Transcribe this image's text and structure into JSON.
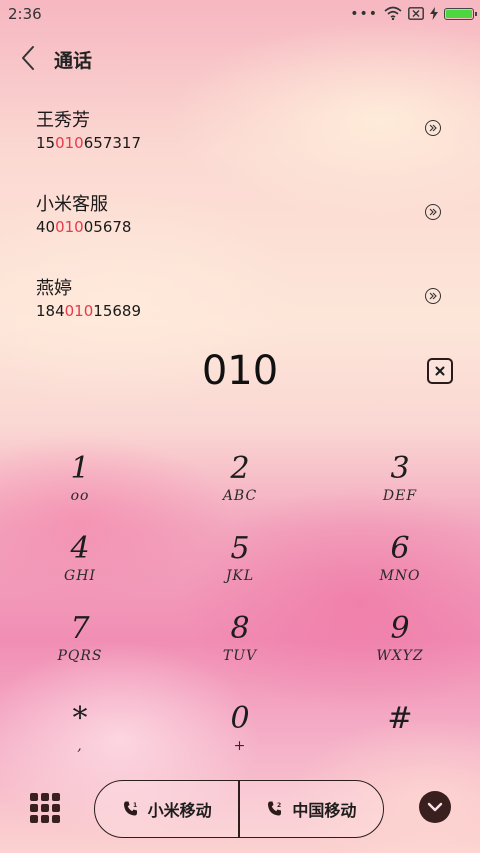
{
  "status_bar": {
    "time": "2:36",
    "more_dots": "•••",
    "battery_color": "#4cd640"
  },
  "header": {
    "title": "通话",
    "back_icon": "chevron-left-icon"
  },
  "contacts": [
    {
      "name": "王秀芳",
      "number_prefix": "15",
      "number_match": "010",
      "number_suffix": "657317"
    },
    {
      "name": "小米客服",
      "number_prefix": "40",
      "number_match": "010",
      "number_suffix": "05678"
    },
    {
      "name": "燕婷",
      "number_prefix": "184",
      "number_match": "010",
      "number_suffix": "15689"
    }
  ],
  "highlight_color": "#e8384b",
  "dialer": {
    "digits": "010"
  },
  "keypad": [
    {
      "digit": "1",
      "letters": "oo"
    },
    {
      "digit": "2",
      "letters": "ABC"
    },
    {
      "digit": "3",
      "letters": "DEF"
    },
    {
      "digit": "4",
      "letters": "GHI"
    },
    {
      "digit": "5",
      "letters": "JKL"
    },
    {
      "digit": "6",
      "letters": "MNO"
    },
    {
      "digit": "7",
      "letters": "PQRS"
    },
    {
      "digit": "8",
      "letters": "TUV"
    },
    {
      "digit": "9",
      "letters": "WXYZ"
    },
    {
      "digit": "*",
      "letters": ","
    },
    {
      "digit": "0",
      "letters": "+"
    },
    {
      "digit": "#",
      "letters": ""
    }
  ],
  "bottom_bar": {
    "sim1_label": "小米移动",
    "sim2_label": "中国移动",
    "sim2_badge": "2"
  }
}
